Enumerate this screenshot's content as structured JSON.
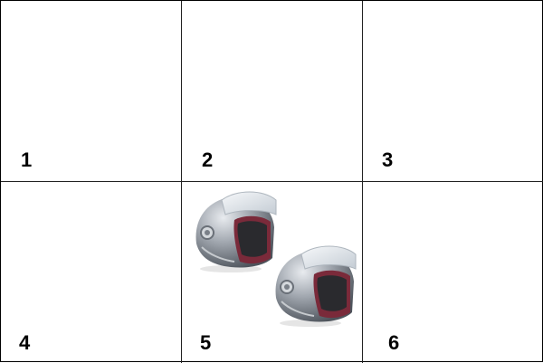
{
  "grid": {
    "cells": [
      {
        "number": "1",
        "content": "empty"
      },
      {
        "number": "2",
        "content": "empty"
      },
      {
        "number": "3",
        "content": "empty"
      },
      {
        "number": "4",
        "content": "empty"
      },
      {
        "number": "5",
        "content": "two helmets"
      },
      {
        "number": "6",
        "content": "empty"
      }
    ]
  },
  "colors": {
    "border": "#222222",
    "helmet_shell": "#9aa0a8",
    "helmet_lining": "#7a2a3a",
    "visor": "#dfe6ec"
  },
  "icons": [
    "helmet-icon"
  ]
}
